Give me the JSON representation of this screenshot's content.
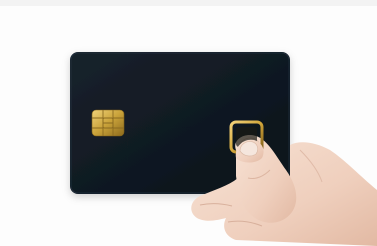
{
  "scene": {
    "subject": "fingerprint-biometric-card-held-in-hand",
    "colors": {
      "background": "#fdfdfd",
      "card": "#101922",
      "chip_gold": "#c9a23a",
      "sensor_gold": "#d2a63a",
      "skin": "#f2d8c8"
    },
    "icons": [
      "emv-chip-icon",
      "fingerprint-sensor-icon",
      "hand"
    ]
  }
}
